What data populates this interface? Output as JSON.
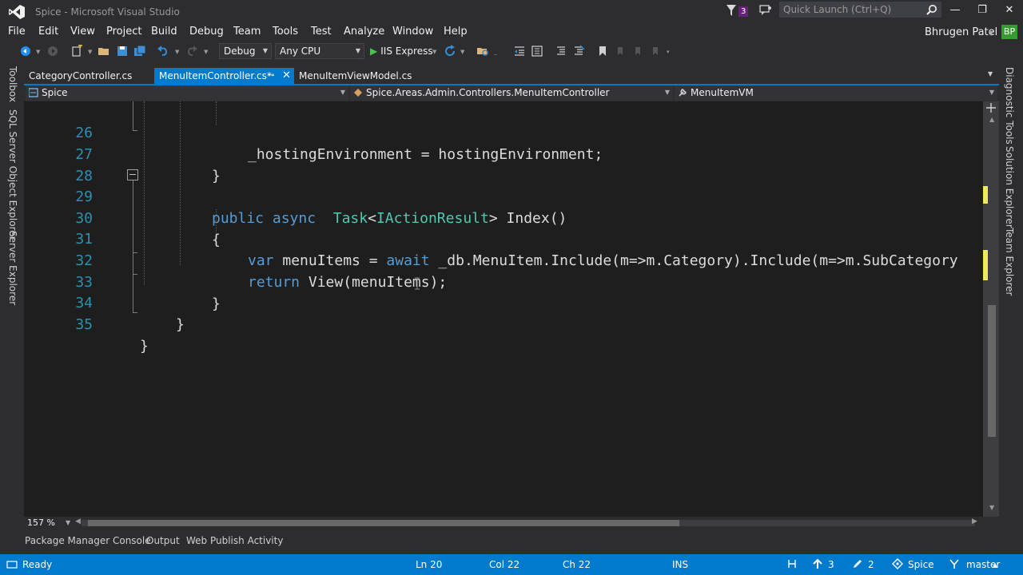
{
  "window": {
    "title": "Spice - Microsoft Visual Studio",
    "notification_count": "3",
    "quick_launch_placeholder": "Quick Launch (Ctrl+Q)",
    "controls": [
      "—",
      "❐",
      "✕"
    ]
  },
  "menu": {
    "items": [
      "File",
      "Edit",
      "View",
      "Project",
      "Build",
      "Debug",
      "Team",
      "Tools",
      "Test",
      "Analyze",
      "Window",
      "Help"
    ],
    "user_name": "Bhrugen Patel",
    "user_initials": "BP"
  },
  "toolbar": {
    "configuration": "Debug",
    "platform": "Any CPU",
    "run_target": "IIS Express"
  },
  "tabs": [
    {
      "label": "CategoryController.cs",
      "active": false
    },
    {
      "label": "MenuItemController.cs*",
      "active": true
    },
    {
      "label": "MenuItemViewModel.cs",
      "active": false
    }
  ],
  "navbar": {
    "project": "Spice",
    "class": "Spice.Areas.Admin.Controllers.MenuItemController",
    "member": "MenuItemVM"
  },
  "side_tabs": {
    "left": [
      "Toolbox",
      "SQL Server Object Explorer",
      "Server Explorer"
    ],
    "right": [
      "Diagnostic Tools",
      "Solution Explorer",
      "Team Explorer"
    ]
  },
  "code": {
    "lines": [
      {
        "num": "26",
        "text": "_hostingEnvironment = hostingEnvironment;"
      },
      {
        "num": "27",
        "text": "}"
      },
      {
        "num": "28",
        "text": ""
      },
      {
        "num": "29",
        "text": "public async  Task<IActionResult> Index()"
      },
      {
        "num": "30",
        "text": "{"
      },
      {
        "num": "31",
        "text": "var menuItems = await _db.MenuItem.Include(m=>m.Category).Include(m=>m.SubCategory"
      },
      {
        "num": "32",
        "text": "return View(menuItems);"
      },
      {
        "num": "33",
        "text": "}"
      },
      {
        "num": "34",
        "text": "}"
      },
      {
        "num": "35",
        "text": "}"
      }
    ]
  },
  "zoom": "157 %",
  "tool_windows": [
    "Package Manager Console",
    "Output",
    "Web Publish Activity"
  ],
  "status": {
    "state": "Ready",
    "ln": "Ln 20",
    "col": "Col 22",
    "ch": "Ch 22",
    "mode": "INS",
    "pushes": "3",
    "changes": "2",
    "repo": "Spice",
    "branch": "master"
  },
  "colors": {
    "accent": "#007acc",
    "keyword": "#569cd6",
    "type": "#4ec9b0",
    "line_number": "#2b91af",
    "editor_bg": "#1e1e1e",
    "chrome_bg": "#2d2d30"
  }
}
